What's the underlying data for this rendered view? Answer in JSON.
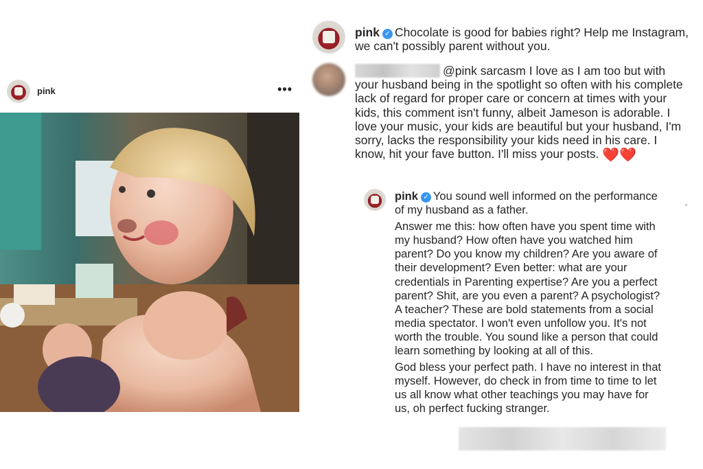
{
  "post": {
    "username": "pink",
    "more_icon": "more-options-icon",
    "photo_icon": "photo-image"
  },
  "caption": {
    "username": "pink",
    "text": "Chocolate is good for babies right? Help me Instagram, we can't possibly parent without you."
  },
  "comment": {
    "mention": "@pink",
    "text": "sarcasm I love as I am too but with your husband being in the spotlight so often with his complete lack of regard for proper care or concern at times with your kids, this comment isn't funny, albeit Jameson is adorable. I love your music, your kids are beautiful but your husband, I'm sorry, lacks the responsibility your kids need in his care. I know, hit your fave button.  I'll miss your posts.",
    "hearts": "❤️❤️"
  },
  "reply": {
    "username": "pink",
    "p1": "You sound well informed on the performance of my husband as a father.",
    "p2": "Answer me this: how often have you spent time with my husband? How often have you watched him parent? Do you know my children? Are you aware of their development? Even better: what are your credentials in Parenting expertise? Are you a perfect parent? Shit, are you even a parent? A psychologist? A teacher? These are bold statements from a social media spectator. I won't even unfollow you. It's not worth the trouble. You sound like a person that could learn something by looking at all of this.",
    "p3": "God bless your perfect path. I have no interest in that myself. However, do check in from time to time to let us all know what other teachings you may have for us, oh perfect fucking stranger."
  },
  "colors": {
    "text": "#262626",
    "verified": "#3897f0",
    "heart": "#e8202a"
  }
}
